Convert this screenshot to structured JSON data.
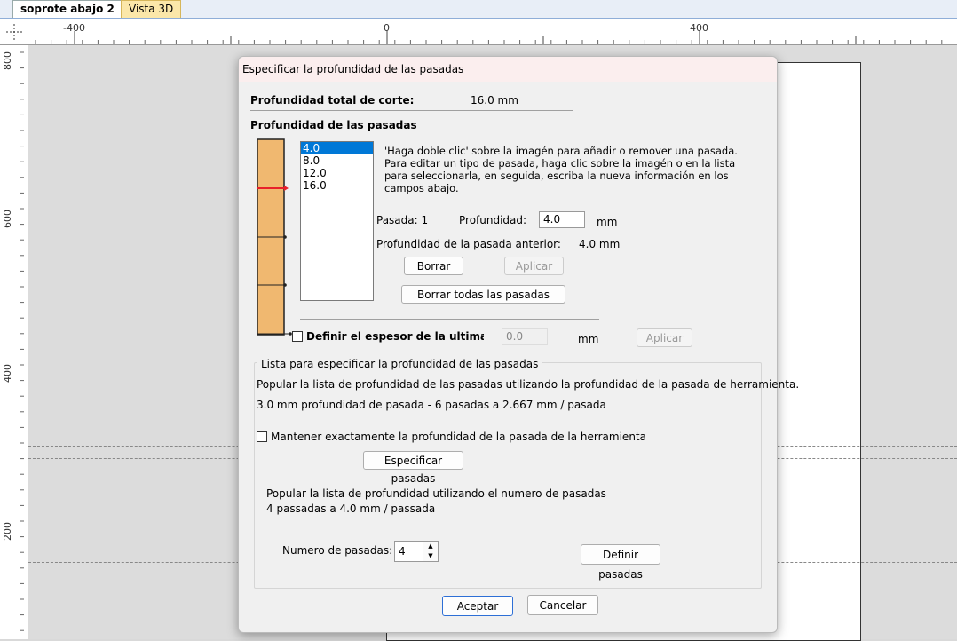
{
  "tabs": [
    {
      "label": "soprote abajo 2",
      "active": true
    },
    {
      "label": "Vista 3D",
      "active": false
    }
  ],
  "ruler": {
    "top_labels": [
      "-400",
      "0",
      "400"
    ],
    "left_labels": [
      "800",
      "600",
      "400",
      "200"
    ]
  },
  "dialog": {
    "title": "Especificar la profundidad de las pasadas",
    "total_depth_label": "Profundidad total de corte:",
    "total_depth_value": "16.0 mm",
    "passes_heading": "Profundidad de las pasadas",
    "pass_list": [
      "4.0",
      "8.0",
      "12.0",
      "16.0"
    ],
    "selected_pass_index": 0,
    "instructions": [
      "'Haga doble clic' sobre la imagén para añadir o remover una pasada.",
      "Para editar un tipo de pasada, haga clic sobre la imagén o en la lista",
      "para seleccionarla, en seguida, escriba la nueva información en los",
      "campos abajo."
    ],
    "pass_label": "Pasada: 1",
    "depth_label": "Profundidad:",
    "depth_value": "4.0",
    "mm": "mm",
    "prev_depth_label": "Profundidad de la pasada anterior:",
    "prev_depth_value": "4.0 mm",
    "delete_button": "Borrar",
    "apply_button": "Aplicar",
    "delete_all_button": "Borrar todas las pasadas",
    "last_thickness_label": "Definir el espesor de la ultima pa",
    "last_thickness_value": "0.0",
    "last_thickness_checked": false,
    "group_title": "Lista para especificar la profundidad de las pasadas",
    "populate_tool_text": "Popular la lista de profundidad de las pasadas utilizando la profundidad de la pasada de herramienta.",
    "tool_pass_summary": "3.0 mm profundidad de pasada - 6 pasadas a 2.667 mm / pasada",
    "keep_exact_label": "Mantener exactamente la profundidad de la pasada de la herramienta",
    "keep_exact_checked": false,
    "specify_passes_button": "Especificar pasadas",
    "populate_number_text": "Popular la lista de profundidad utilizando el numero de pasadas",
    "number_summary": "4 passadas a 4.0 mm / passada",
    "number_label": "Numero de pasadas:",
    "number_value": "4",
    "define_passes_button": "Definir pasadas",
    "ok_button": "Aceptar",
    "cancel_button": "Cancelar"
  },
  "colors": {
    "material": "#f0b870",
    "marker": "#e8202a",
    "selection": "#0078d7",
    "default_button_border": "#2d6fd6"
  }
}
